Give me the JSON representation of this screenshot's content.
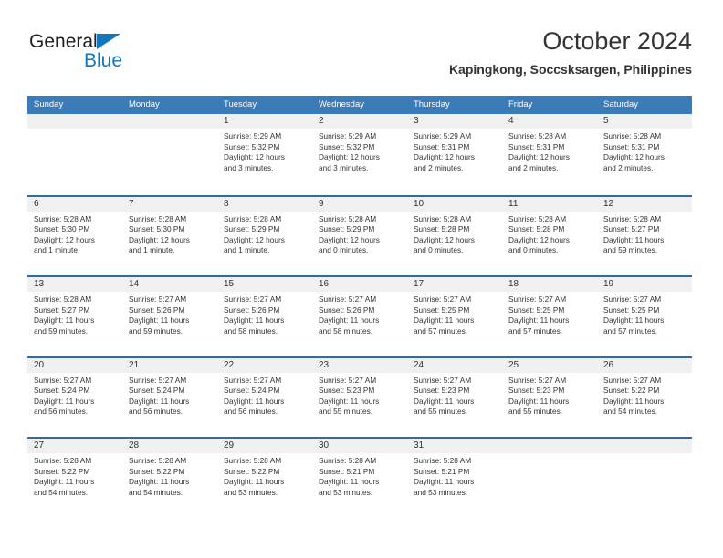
{
  "brand": {
    "name_top": "General",
    "name_bottom": "Blue",
    "triangle_color": "#1277bc",
    "text_color": "#231f20"
  },
  "header": {
    "title": "October 2024",
    "subtitle": "Kapingkong, Soccsksargen, Philippines"
  },
  "theme": {
    "header_bg": "#3b7cb8",
    "row_border": "#2d6ca8",
    "daynum_band": "#f0f0f0",
    "text": "#333333"
  },
  "weekdays": [
    "Sunday",
    "Monday",
    "Tuesday",
    "Wednesday",
    "Thursday",
    "Friday",
    "Saturday"
  ],
  "weeks": [
    [
      {
        "day": "",
        "sunrise": "",
        "sunset": "",
        "daylight": "",
        "daylight2": ""
      },
      {
        "day": "",
        "sunrise": "",
        "sunset": "",
        "daylight": "",
        "daylight2": ""
      },
      {
        "day": "1",
        "sunrise": "Sunrise: 5:29 AM",
        "sunset": "Sunset: 5:32 PM",
        "daylight": "Daylight: 12 hours",
        "daylight2": "and 3 minutes."
      },
      {
        "day": "2",
        "sunrise": "Sunrise: 5:29 AM",
        "sunset": "Sunset: 5:32 PM",
        "daylight": "Daylight: 12 hours",
        "daylight2": "and 3 minutes."
      },
      {
        "day": "3",
        "sunrise": "Sunrise: 5:29 AM",
        "sunset": "Sunset: 5:31 PM",
        "daylight": "Daylight: 12 hours",
        "daylight2": "and 2 minutes."
      },
      {
        "day": "4",
        "sunrise": "Sunrise: 5:28 AM",
        "sunset": "Sunset: 5:31 PM",
        "daylight": "Daylight: 12 hours",
        "daylight2": "and 2 minutes."
      },
      {
        "day": "5",
        "sunrise": "Sunrise: 5:28 AM",
        "sunset": "Sunset: 5:31 PM",
        "daylight": "Daylight: 12 hours",
        "daylight2": "and 2 minutes."
      }
    ],
    [
      {
        "day": "6",
        "sunrise": "Sunrise: 5:28 AM",
        "sunset": "Sunset: 5:30 PM",
        "daylight": "Daylight: 12 hours",
        "daylight2": "and 1 minute."
      },
      {
        "day": "7",
        "sunrise": "Sunrise: 5:28 AM",
        "sunset": "Sunset: 5:30 PM",
        "daylight": "Daylight: 12 hours",
        "daylight2": "and 1 minute."
      },
      {
        "day": "8",
        "sunrise": "Sunrise: 5:28 AM",
        "sunset": "Sunset: 5:29 PM",
        "daylight": "Daylight: 12 hours",
        "daylight2": "and 1 minute."
      },
      {
        "day": "9",
        "sunrise": "Sunrise: 5:28 AM",
        "sunset": "Sunset: 5:29 PM",
        "daylight": "Daylight: 12 hours",
        "daylight2": "and 0 minutes."
      },
      {
        "day": "10",
        "sunrise": "Sunrise: 5:28 AM",
        "sunset": "Sunset: 5:28 PM",
        "daylight": "Daylight: 12 hours",
        "daylight2": "and 0 minutes."
      },
      {
        "day": "11",
        "sunrise": "Sunrise: 5:28 AM",
        "sunset": "Sunset: 5:28 PM",
        "daylight": "Daylight: 12 hours",
        "daylight2": "and 0 minutes."
      },
      {
        "day": "12",
        "sunrise": "Sunrise: 5:28 AM",
        "sunset": "Sunset: 5:27 PM",
        "daylight": "Daylight: 11 hours",
        "daylight2": "and 59 minutes."
      }
    ],
    [
      {
        "day": "13",
        "sunrise": "Sunrise: 5:28 AM",
        "sunset": "Sunset: 5:27 PM",
        "daylight": "Daylight: 11 hours",
        "daylight2": "and 59 minutes."
      },
      {
        "day": "14",
        "sunrise": "Sunrise: 5:27 AM",
        "sunset": "Sunset: 5:26 PM",
        "daylight": "Daylight: 11 hours",
        "daylight2": "and 59 minutes."
      },
      {
        "day": "15",
        "sunrise": "Sunrise: 5:27 AM",
        "sunset": "Sunset: 5:26 PM",
        "daylight": "Daylight: 11 hours",
        "daylight2": "and 58 minutes."
      },
      {
        "day": "16",
        "sunrise": "Sunrise: 5:27 AM",
        "sunset": "Sunset: 5:26 PM",
        "daylight": "Daylight: 11 hours",
        "daylight2": "and 58 minutes."
      },
      {
        "day": "17",
        "sunrise": "Sunrise: 5:27 AM",
        "sunset": "Sunset: 5:25 PM",
        "daylight": "Daylight: 11 hours",
        "daylight2": "and 57 minutes."
      },
      {
        "day": "18",
        "sunrise": "Sunrise: 5:27 AM",
        "sunset": "Sunset: 5:25 PM",
        "daylight": "Daylight: 11 hours",
        "daylight2": "and 57 minutes."
      },
      {
        "day": "19",
        "sunrise": "Sunrise: 5:27 AM",
        "sunset": "Sunset: 5:25 PM",
        "daylight": "Daylight: 11 hours",
        "daylight2": "and 57 minutes."
      }
    ],
    [
      {
        "day": "20",
        "sunrise": "Sunrise: 5:27 AM",
        "sunset": "Sunset: 5:24 PM",
        "daylight": "Daylight: 11 hours",
        "daylight2": "and 56 minutes."
      },
      {
        "day": "21",
        "sunrise": "Sunrise: 5:27 AM",
        "sunset": "Sunset: 5:24 PM",
        "daylight": "Daylight: 11 hours",
        "daylight2": "and 56 minutes."
      },
      {
        "day": "22",
        "sunrise": "Sunrise: 5:27 AM",
        "sunset": "Sunset: 5:24 PM",
        "daylight": "Daylight: 11 hours",
        "daylight2": "and 56 minutes."
      },
      {
        "day": "23",
        "sunrise": "Sunrise: 5:27 AM",
        "sunset": "Sunset: 5:23 PM",
        "daylight": "Daylight: 11 hours",
        "daylight2": "and 55 minutes."
      },
      {
        "day": "24",
        "sunrise": "Sunrise: 5:27 AM",
        "sunset": "Sunset: 5:23 PM",
        "daylight": "Daylight: 11 hours",
        "daylight2": "and 55 minutes."
      },
      {
        "day": "25",
        "sunrise": "Sunrise: 5:27 AM",
        "sunset": "Sunset: 5:23 PM",
        "daylight": "Daylight: 11 hours",
        "daylight2": "and 55 minutes."
      },
      {
        "day": "26",
        "sunrise": "Sunrise: 5:27 AM",
        "sunset": "Sunset: 5:22 PM",
        "daylight": "Daylight: 11 hours",
        "daylight2": "and 54 minutes."
      }
    ],
    [
      {
        "day": "27",
        "sunrise": "Sunrise: 5:28 AM",
        "sunset": "Sunset: 5:22 PM",
        "daylight": "Daylight: 11 hours",
        "daylight2": "and 54 minutes."
      },
      {
        "day": "28",
        "sunrise": "Sunrise: 5:28 AM",
        "sunset": "Sunset: 5:22 PM",
        "daylight": "Daylight: 11 hours",
        "daylight2": "and 54 minutes."
      },
      {
        "day": "29",
        "sunrise": "Sunrise: 5:28 AM",
        "sunset": "Sunset: 5:22 PM",
        "daylight": "Daylight: 11 hours",
        "daylight2": "and 53 minutes."
      },
      {
        "day": "30",
        "sunrise": "Sunrise: 5:28 AM",
        "sunset": "Sunset: 5:21 PM",
        "daylight": "Daylight: 11 hours",
        "daylight2": "and 53 minutes."
      },
      {
        "day": "31",
        "sunrise": "Sunrise: 5:28 AM",
        "sunset": "Sunset: 5:21 PM",
        "daylight": "Daylight: 11 hours",
        "daylight2": "and 53 minutes."
      },
      {
        "day": "",
        "sunrise": "",
        "sunset": "",
        "daylight": "",
        "daylight2": ""
      },
      {
        "day": "",
        "sunrise": "",
        "sunset": "",
        "daylight": "",
        "daylight2": ""
      }
    ]
  ]
}
